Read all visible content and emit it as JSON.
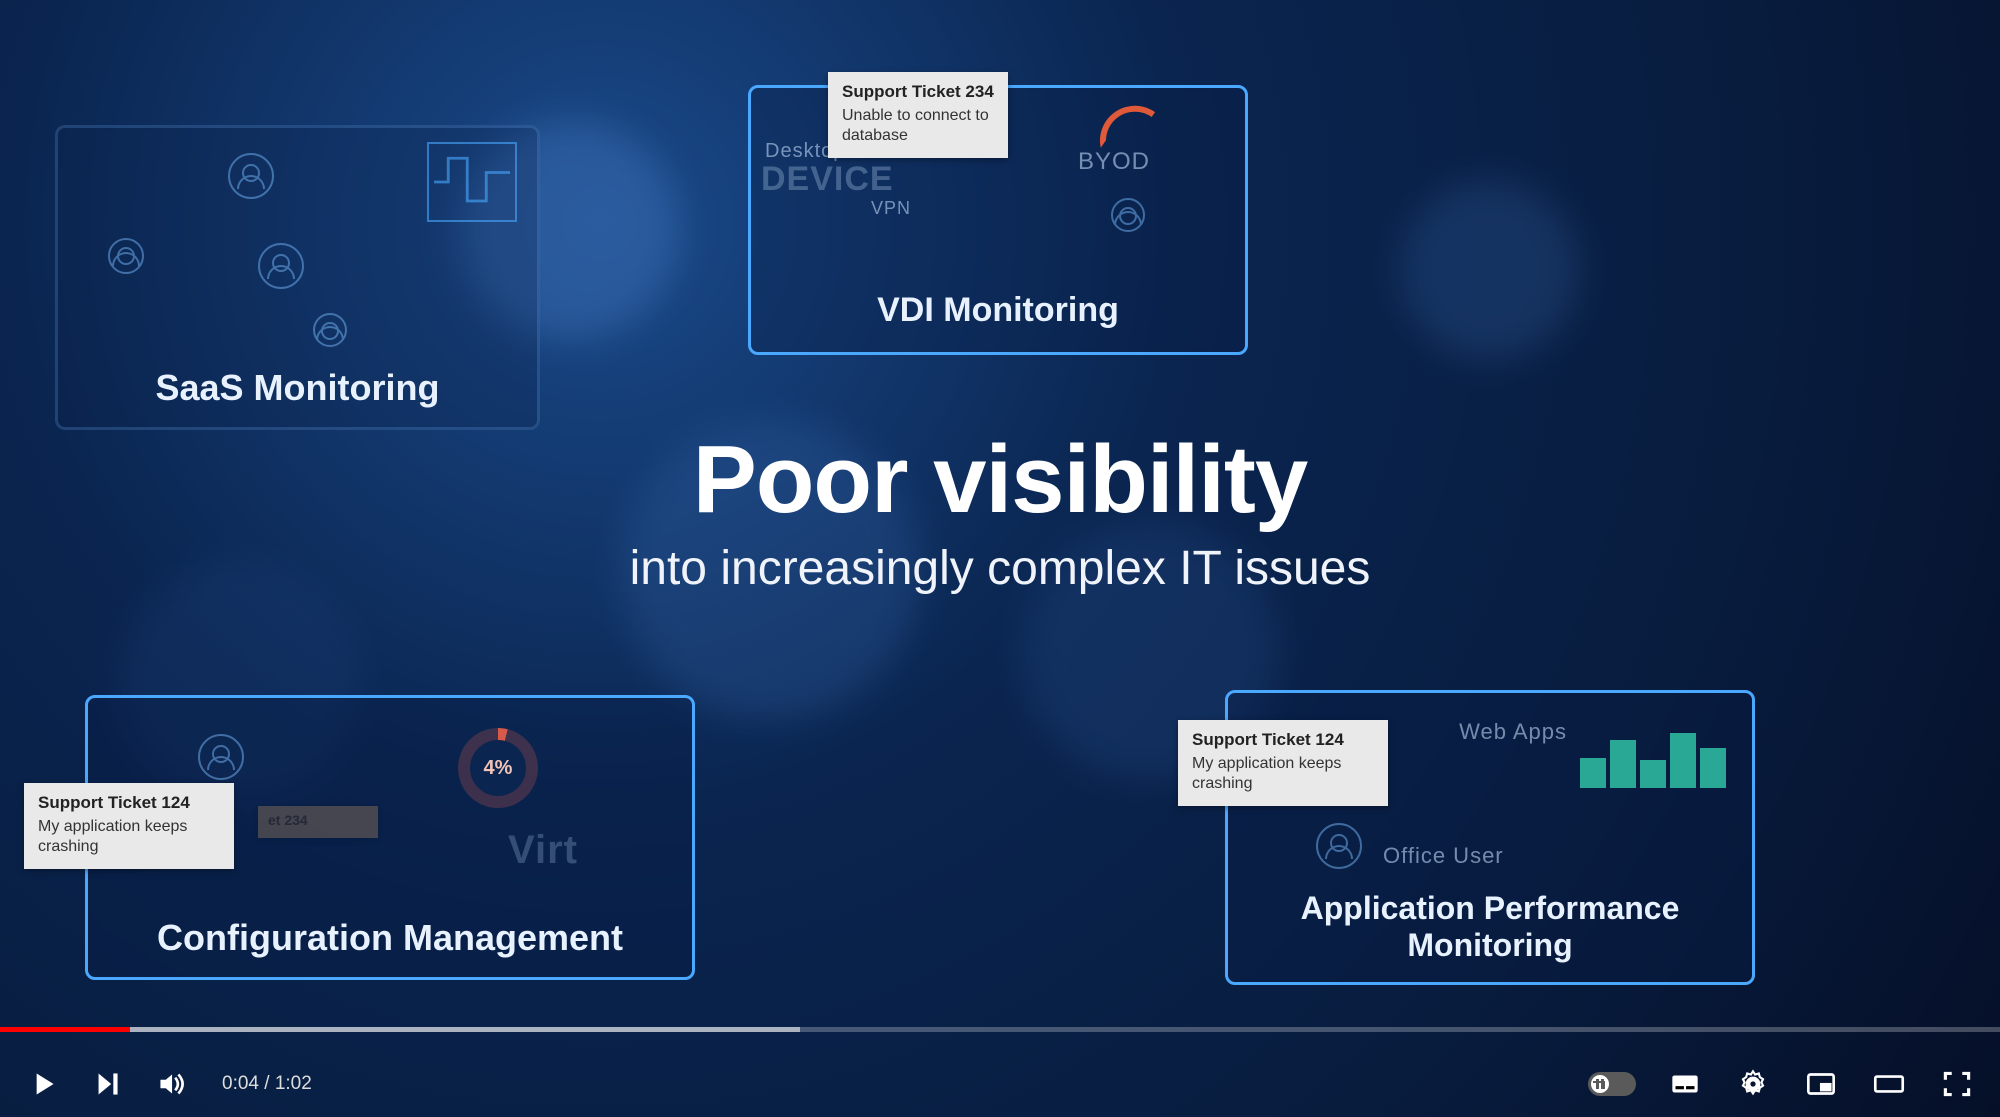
{
  "headline": {
    "line1": "Poor visibility",
    "line2": "into increasingly complex IT issues"
  },
  "cards": {
    "saas": {
      "title": "SaaS Monitoring"
    },
    "vdi": {
      "title": "VDI Monitoring",
      "label_device": "DEVICE",
      "label_vpn": "VPN",
      "label_byod": "BYOD",
      "label_desktops": "Desktops"
    },
    "config": {
      "title": "Configuration Management",
      "donut_value": "4%",
      "label_virt": "Virt",
      "faded_ticket_title": "et 234"
    },
    "apm": {
      "title": "Application Performance Monitoring",
      "label_webapps": "Web Apps",
      "label_officeuser": "Office User"
    }
  },
  "tickets": {
    "t234": {
      "title": "Support Ticket 234",
      "body": "Unable to connect to database"
    },
    "t124a": {
      "title": "Support Ticket 124",
      "body": "My application keeps crashing"
    },
    "t124b": {
      "title": "Support Ticket 124",
      "body": "My application keeps crashing"
    }
  },
  "player": {
    "current_time": "0:04",
    "duration": "1:02",
    "time_separator": " / ",
    "progress_played_pct": 6.5,
    "progress_loaded_pct": 40
  }
}
